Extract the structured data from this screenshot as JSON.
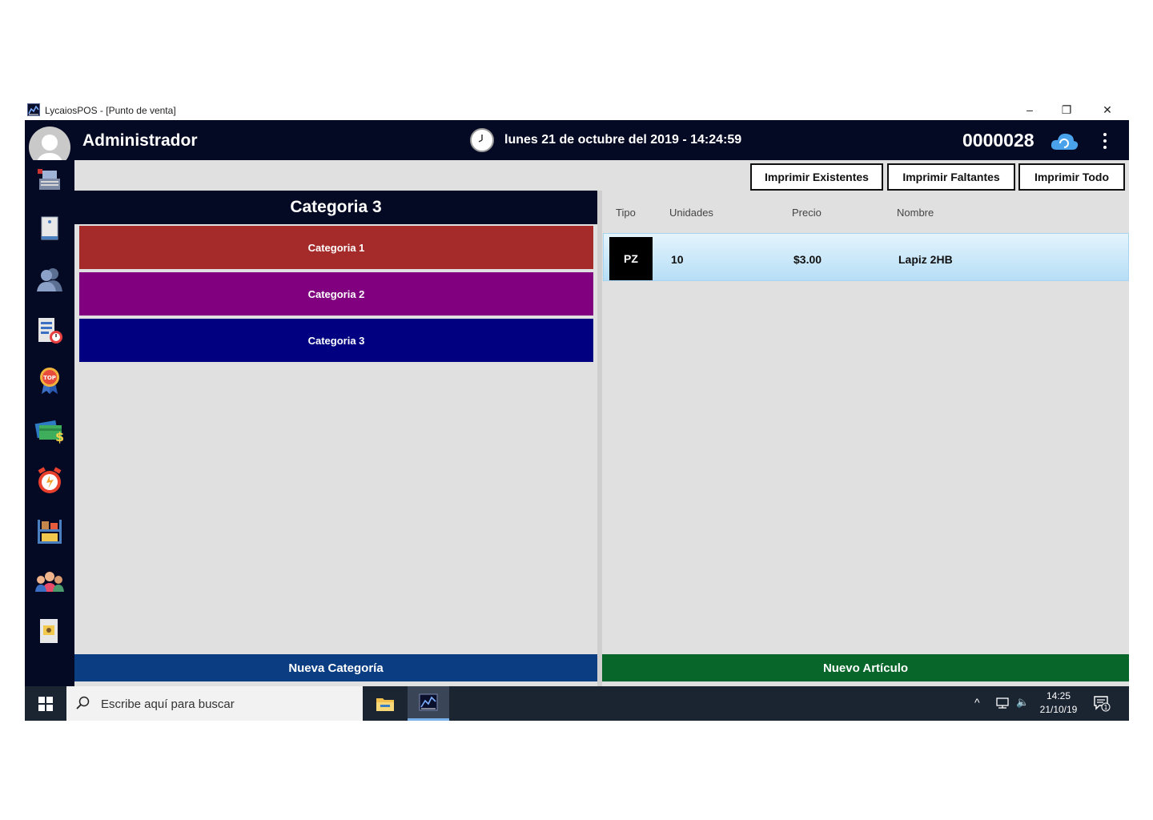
{
  "window": {
    "title": "LycaiosPOS - [Punto de venta]",
    "minimize": "–",
    "restore": "❐",
    "close": "✕"
  },
  "header": {
    "user_name": "Administrador",
    "datetime": "lunes 21 de octubre del 2019 - 14:24:59",
    "ticket_number": "0000028"
  },
  "sidebar": {
    "items": [
      {
        "icon": "cash-register-icon"
      },
      {
        "icon": "notebook-icon"
      },
      {
        "icon": "users-icon"
      },
      {
        "icon": "report-clock-icon"
      },
      {
        "icon": "top-badge-icon"
      },
      {
        "icon": "money-icon"
      },
      {
        "icon": "alarm-clock-icon"
      },
      {
        "icon": "inventory-shelf-icon"
      },
      {
        "icon": "team-icon"
      },
      {
        "icon": "settings-card-icon"
      }
    ]
  },
  "toolbar": {
    "print_existing": "Imprimir Existentes",
    "print_missing": "Imprimir Faltantes",
    "print_all": "Imprimir Todo"
  },
  "categories": {
    "selected_title": "Categoria 3",
    "items": [
      {
        "label": "Categoria 1",
        "color": "#a52a2a"
      },
      {
        "label": "Categoria 2",
        "color": "#800080"
      },
      {
        "label": "Categoria 3",
        "color": "#000080"
      }
    ],
    "new_button": "Nueva Categoría"
  },
  "articles": {
    "columns": [
      "Tipo",
      "Unidades",
      "Precio",
      "Nombre"
    ],
    "rows": [
      {
        "tipo": "PZ",
        "unidades": "10",
        "precio": "$3.00",
        "nombre": "Lapiz 2HB"
      }
    ],
    "new_button": "Nuevo Artículo"
  },
  "taskbar": {
    "search_placeholder": "Escribe aquí para buscar",
    "time": "14:25",
    "date": "21/10/19",
    "notification_count": "1"
  },
  "colors": {
    "header_bg": "#050a24",
    "new_category": "#0a3d82",
    "new_article": "#08662a"
  }
}
